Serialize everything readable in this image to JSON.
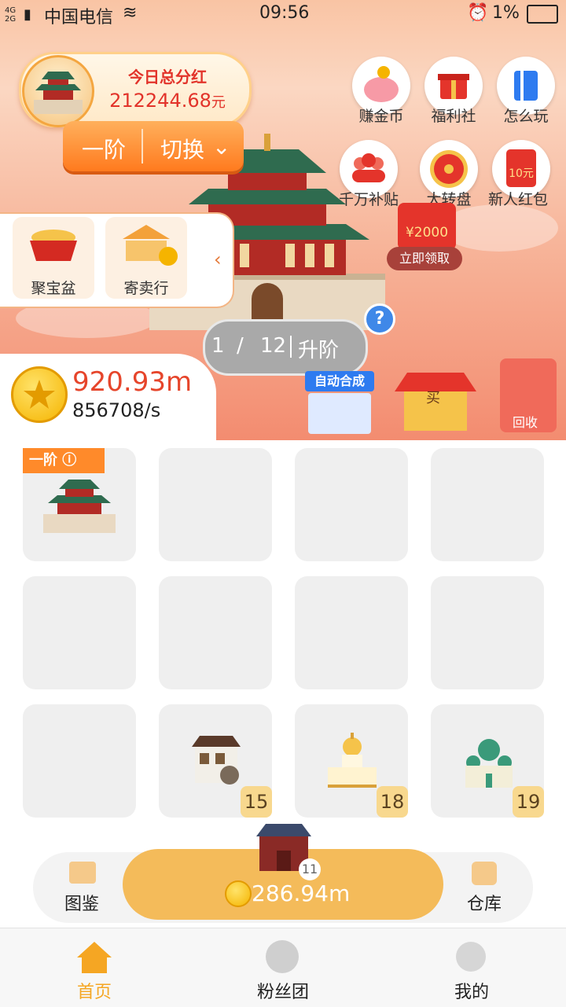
{
  "status_bar": {
    "carrier": "中国电信",
    "time": "09:56",
    "battery": "1%",
    "network": "4G 2G"
  },
  "dividend": {
    "title": "今日总分红",
    "amount": "212244.68",
    "unit": "元"
  },
  "tier": {
    "current": "一阶",
    "switch_label": "切换"
  },
  "top_actions": [
    {
      "label": "赚金币",
      "icon": "piggy-bank-icon"
    },
    {
      "label": "福利社",
      "icon": "gift-box-icon"
    },
    {
      "label": "怎么玩",
      "icon": "guide-book-icon"
    },
    {
      "label": "千万补贴",
      "icon": "subsidy-crowd-icon"
    },
    {
      "label": "大转盘",
      "icon": "lucky-wheel-icon"
    },
    {
      "label": "新人红包",
      "icon": "red-envelope-icon",
      "badge": "10元"
    }
  ],
  "side_panel": {
    "items": [
      {
        "label": "聚宝盆",
        "tag": "聚宝盆"
      },
      {
        "label": "寄卖行",
        "tag": "¥"
      }
    ]
  },
  "red_packet": {
    "amount": "¥2000",
    "claim_label": "立即领取"
  },
  "level": {
    "current": "1",
    "separator": "/",
    "total": "12",
    "upgrade_label": "升阶",
    "help": "?"
  },
  "coins": {
    "balance": "920.93m",
    "rate": "856708/s"
  },
  "shops": {
    "auto_merge_label": "自动合成",
    "buy_label": "买",
    "recycle_label": "回收"
  },
  "grid": {
    "first_cell_badge": "一阶",
    "cells": [
      {
        "building": "bell-tower",
        "level": ""
      },
      {
        "building": "",
        "level": ""
      },
      {
        "building": "",
        "level": ""
      },
      {
        "building": "",
        "level": ""
      },
      {
        "building": "",
        "level": ""
      },
      {
        "building": "",
        "level": ""
      },
      {
        "building": "",
        "level": ""
      },
      {
        "building": "",
        "level": ""
      },
      {
        "building": "",
        "level": ""
      },
      {
        "building": "house",
        "level": "15"
      },
      {
        "building": "capitol",
        "level": "18"
      },
      {
        "building": "mosque",
        "level": "19"
      }
    ]
  },
  "dock": {
    "left_label": "图鉴",
    "right_label": "仓库",
    "buy_price": "286.94m",
    "buy_level": "11"
  },
  "tabbar": {
    "items": [
      {
        "label": "首页",
        "active": true
      },
      {
        "label": "粉丝团",
        "active": false
      },
      {
        "label": "我的",
        "active": false
      }
    ]
  },
  "colors": {
    "accent_orange": "#ff7a1e",
    "coin_red": "#e6452b",
    "tab_active": "#f5a623"
  }
}
